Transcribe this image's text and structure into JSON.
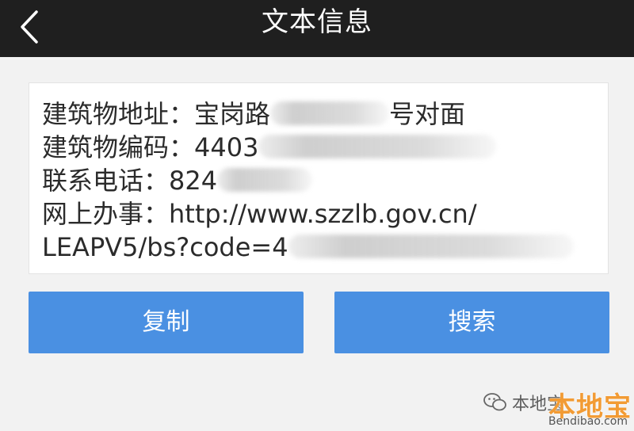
{
  "header": {
    "title": "文本信息",
    "back_icon": "chevron-left-icon"
  },
  "text_card": {
    "lines": [
      {
        "label": "建筑物地址：",
        "visible_prefix": "宝岗路",
        "visible_suffix": "号对面"
      },
      {
        "label": "建筑物编码：",
        "visible_prefix": "4403"
      },
      {
        "label": "联系电话：",
        "visible_prefix": "824"
      },
      {
        "label": "网上办事：",
        "visible_prefix": "http://www.szzlb.gov.cn/"
      },
      {
        "label": "",
        "visible_prefix": "LEAPV5/bs?code=4"
      }
    ]
  },
  "buttons": {
    "copy_label": "复制",
    "search_label": "搜索"
  },
  "watermark": {
    "account_text": "本地宝",
    "brand": "本地宝",
    "url": "Bendibao.com"
  },
  "colors": {
    "topbar": "#1f1f1f",
    "button": "#4a90e2",
    "brand": "#f29b34"
  }
}
